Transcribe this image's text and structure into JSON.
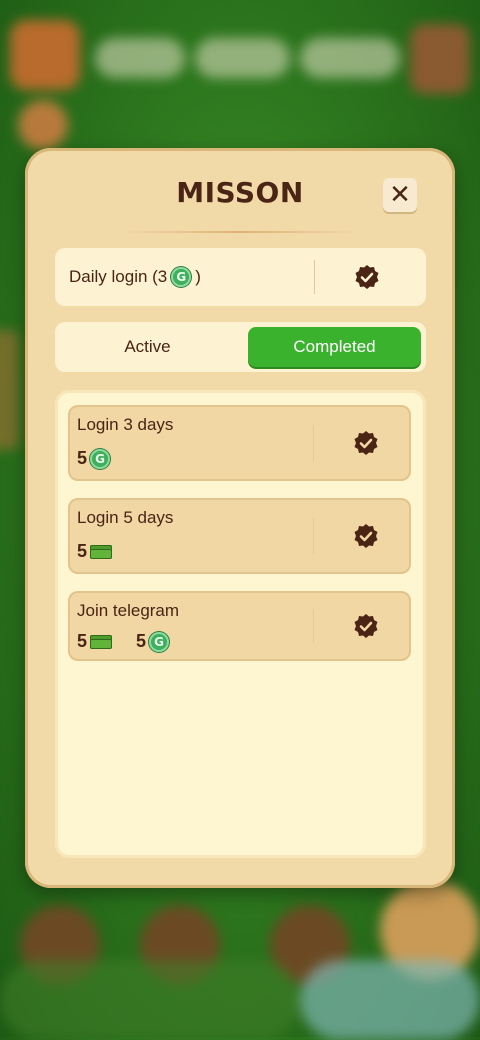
{
  "modal": {
    "title": "MISSON",
    "close_icon": "close-icon"
  },
  "daily": {
    "label_prefix": "Daily login (3",
    "label_suffix": ")",
    "reward_icon": "g-coin-icon",
    "status_icon": "check-badge-icon"
  },
  "tabs": [
    {
      "label": "Active",
      "selected": false
    },
    {
      "label": "Completed",
      "selected": true
    }
  ],
  "colors": {
    "accent": "#3bb22e",
    "panel": "#f2d9a8",
    "text": "#4a2415"
  },
  "missions": [
    {
      "title": "Login 3 days",
      "rewards": [
        {
          "amount": "5",
          "icon": "g-coin-icon"
        }
      ],
      "status_icon": "check-badge-icon"
    },
    {
      "title": "Login 5 days",
      "rewards": [
        {
          "amount": "5",
          "icon": "cash-icon"
        }
      ],
      "status_icon": "check-badge-icon"
    },
    {
      "title": "Join telegram",
      "rewards": [
        {
          "amount": "5",
          "icon": "cash-icon"
        },
        {
          "amount": "5",
          "icon": "g-coin-icon"
        }
      ],
      "status_icon": "check-badge-icon"
    }
  ]
}
